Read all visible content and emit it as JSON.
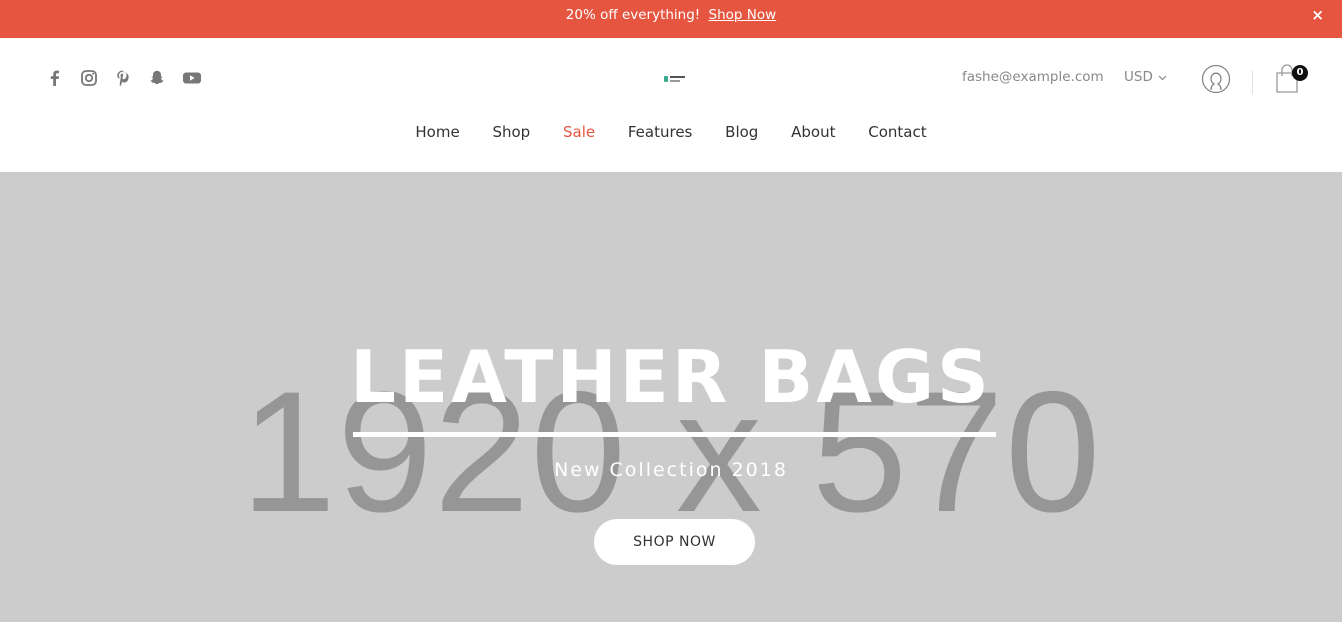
{
  "promo": {
    "text": "20% off everything!",
    "link_label": "Shop Now",
    "close_label": "×"
  },
  "header": {
    "social_icons": [
      "facebook-icon",
      "instagram-icon",
      "pinterest-icon",
      "snapchat-icon",
      "youtube-icon"
    ],
    "logo": "logo",
    "email": "fashe@example.com",
    "currency": "USD",
    "cart_count": "0"
  },
  "nav": {
    "items": [
      "Home",
      "Shop",
      "Sale",
      "Features",
      "Blog",
      "About",
      "Contact"
    ],
    "active": "Sale"
  },
  "hero": {
    "placeholder_text": "1920 x 570",
    "title": "LEATHER BAGS",
    "subtitle": "New Collection 2018",
    "button_label": "SHOP NOW"
  },
  "colors": {
    "accent": "#e65540",
    "hero_bg": "#cccccc",
    "placeholder_text": "#969696"
  }
}
